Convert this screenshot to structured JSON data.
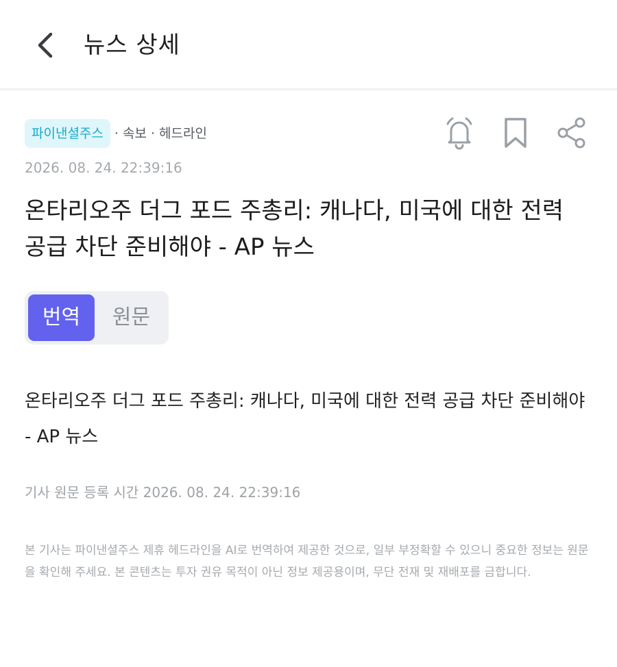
{
  "header": {
    "title": "뉴스 상세",
    "back_icon": "chevron-left-icon"
  },
  "article": {
    "source": "파이낸셜주스",
    "category": "· 속보 · 헤드라인",
    "timestamp": "2026. 08. 24. 22:39:16",
    "headline": "온타리오주 더그 포드 주총리: 캐나다, 미국에 대한 전력 공급 차단 준비해야 - AP 뉴스",
    "body": "온타리오주 더그 포드 주총리: 캐나다, 미국에 대한 전력 공급 차단 준비해야 - AP 뉴스",
    "registered_time": "기사 원문 등록 시간 2026. 08. 24. 22:39:16",
    "disclaimer": "본 기사는 파이낸셜주스 제휴 헤드라인을 AI로 번역하여 제공한 것으로, 일부 부정확할 수 있으니 중요한 정보는 원문을 확인해 주세요. 본 콘텐츠는 투자 권유 목적이 아닌 정보 제공용이며, 무단 전재 및 재배포를 금합니다."
  },
  "actions": {
    "alert_icon": "bell-icon",
    "bookmark_icon": "bookmark-icon",
    "share_icon": "share-icon"
  },
  "toggle": {
    "translated_label": "번역",
    "original_label": "원문",
    "selected": "번역"
  },
  "colors": {
    "accent": "#6262ee",
    "badge_bg": "#dff6fb",
    "badge_text": "#17a9c9",
    "muted": "#a5a9ae"
  }
}
